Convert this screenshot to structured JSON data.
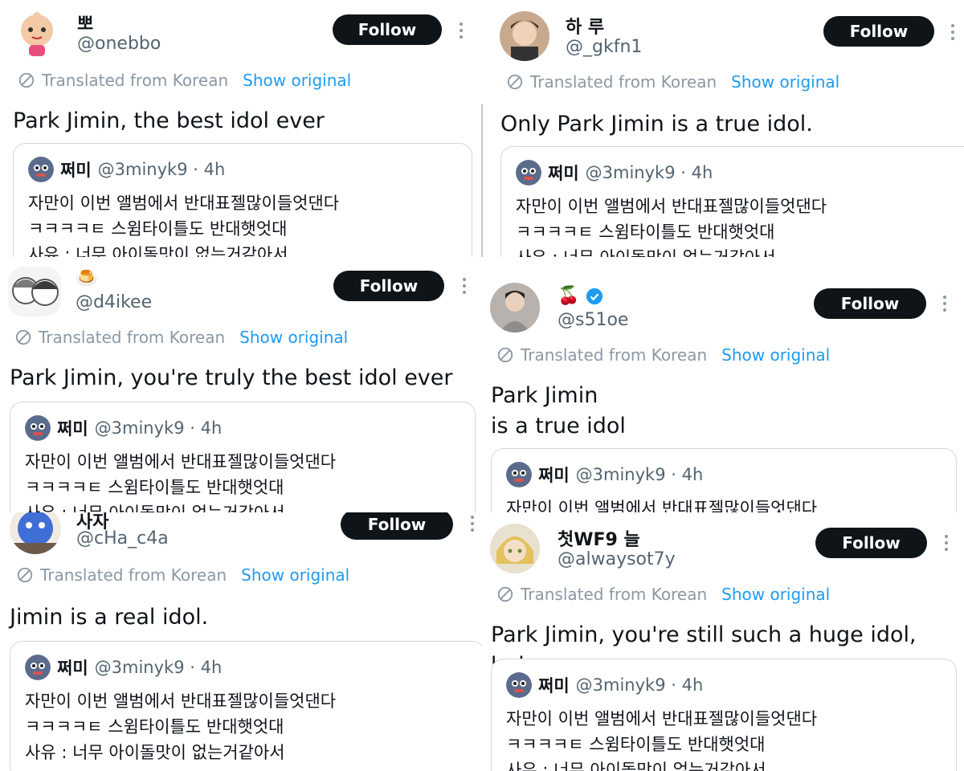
{
  "common": {
    "follow_label": "Follow",
    "translated_label": "Translated from Korean",
    "show_original_label": "Show original"
  },
  "quoted_tweet": {
    "name": "쩌미",
    "meta": "@3minyk9 · 4h",
    "lines": [
      "자만이 이번 앨범에서 반대표젤많이들엇댄다",
      "ㅋㅋㅋㅋㅌ 스윔타이틀도 반대햇엇대",
      "사유 : 너무 아이돌맛이 없는거같아서"
    ]
  },
  "tweets": [
    {
      "name": "뽀",
      "handle": "@onebbo",
      "text": "Park Jimin, the best idol ever"
    },
    {
      "name": "하 루",
      "handle": "@_gkfn1",
      "text": "Only Park Jimin is a true idol."
    },
    {
      "name": "🍮",
      "handle": "@d4ikee",
      "text": "Park Jimin, you're truly the best idol ever"
    },
    {
      "name": "🍒",
      "handle": "@s51oe",
      "text": "Park Jimin\nis a true idol",
      "verified": true
    },
    {
      "name": "사자",
      "handle": "@cHa_c4a",
      "text": "Jimin is a real idol."
    },
    {
      "name": "첫WF9 늘",
      "handle": "@alwaysot7y",
      "text": "Park Jimin, you're still such a huge idol, huh"
    }
  ],
  "colors": {
    "follow_bg": "#0f1419",
    "link": "#1d9bf0",
    "muted": "#536471",
    "verified": "#1d9bf0"
  }
}
